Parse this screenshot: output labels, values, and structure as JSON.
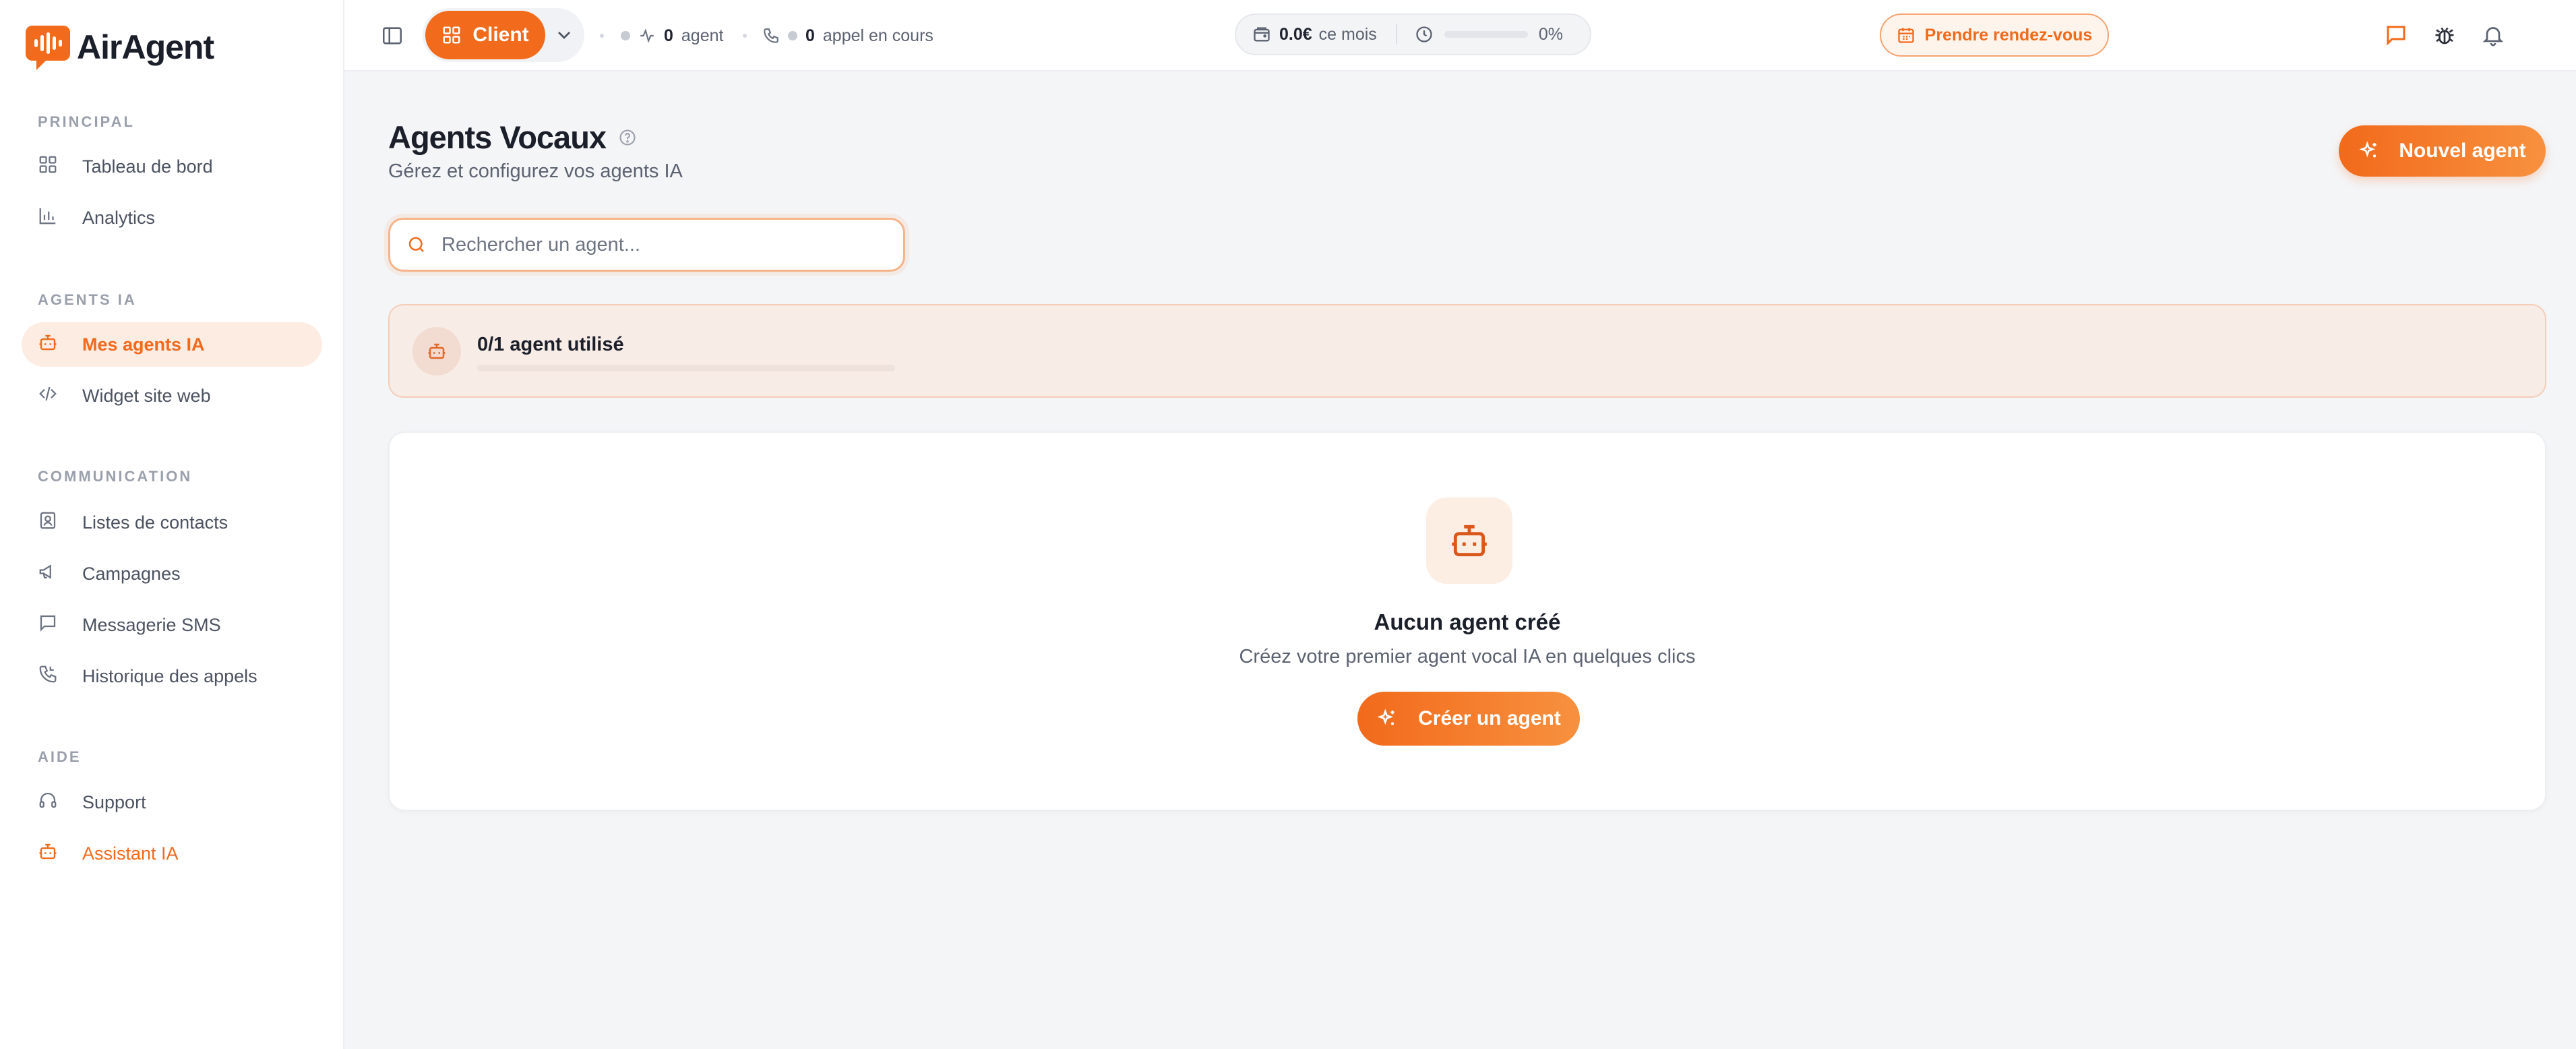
{
  "app": {
    "name": "AirAgent"
  },
  "sidebar": {
    "sections": [
      {
        "title": "PRINCIPAL"
      },
      {
        "title": "AGENTS IA"
      },
      {
        "title": "COMMUNICATION"
      },
      {
        "title": "AIDE"
      }
    ],
    "items": [
      {
        "label": "Tableau de bord",
        "icon": "dashboard-icon"
      },
      {
        "label": "Analytics",
        "icon": "bar-chart-icon"
      },
      {
        "label": "Mes agents IA",
        "icon": "bot-icon",
        "active": true
      },
      {
        "label": "Widget site web",
        "icon": "code-icon"
      },
      {
        "label": "Listes de contacts",
        "icon": "contact-book-icon"
      },
      {
        "label": "Campagnes",
        "icon": "megaphone-icon"
      },
      {
        "label": "Messagerie SMS",
        "icon": "message-icon"
      },
      {
        "label": "Historique des appels",
        "icon": "phone-history-icon"
      },
      {
        "label": "Support",
        "icon": "headphones-icon"
      },
      {
        "label": "Assistant IA",
        "icon": "bot-icon"
      }
    ]
  },
  "topbar": {
    "role_label": "Client",
    "agents_count": "0",
    "agents_label": "agent",
    "calls_count": "0",
    "calls_label": "appel en cours",
    "cost_value": "0.0€",
    "cost_label": "ce mois",
    "usage_percent_label": "0%",
    "usage_fraction": 0,
    "rdv_label": "Prendre rendez-vous"
  },
  "main": {
    "title": "Agents Vocaux",
    "subtitle": "Gérez et configurez vos agents IA",
    "new_agent_label": "Nouvel agent",
    "search_placeholder": "Rechercher un agent...",
    "quota_label": "0/1 agent utilisé",
    "quota_fraction": 0,
    "empty_title": "Aucun agent créé",
    "empty_subtitle": "Créez votre premier agent vocal IA en quelques clics",
    "create_label": "Créer un agent"
  },
  "colors": {
    "accent": "#f26a1b",
    "accent_light": "#fdece2",
    "background": "#f4f5f7"
  }
}
